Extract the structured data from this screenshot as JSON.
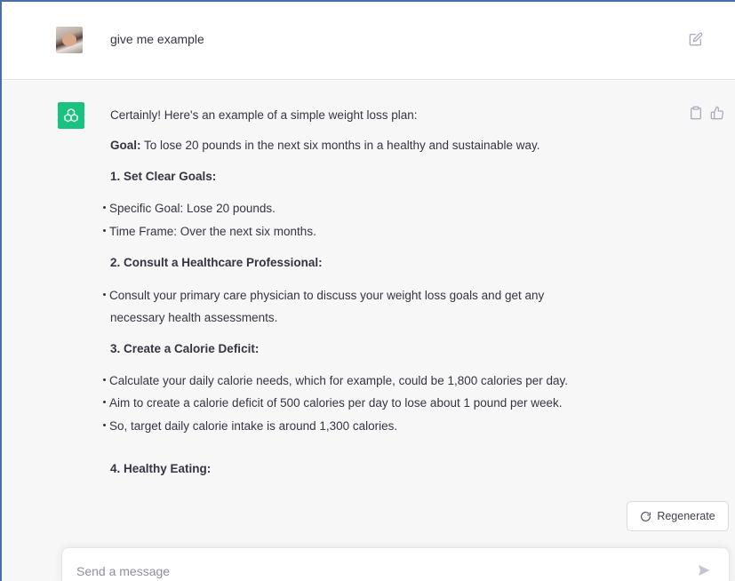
{
  "user_message": {
    "text": "give me example",
    "avatar_icon": "user-photo-avatar",
    "edit_icon": "pencil-square-icon"
  },
  "assistant_message": {
    "avatar_icon": "openai-logo-icon",
    "avatar_color": "#19c37d",
    "intro": "Certainly! Here's an example of a simple weight loss plan:",
    "goal_label": "Goal:",
    "goal_text": " To lose 20 pounds in the next six months in a healthy and sustainable way.",
    "section1_heading": "1. Set Clear Goals:",
    "section1_items": [
      "Specific Goal: Lose 20 pounds.",
      "Time Frame: Over the next six months."
    ],
    "section2_heading": "2. Consult a Healthcare Professional:",
    "section2_item_line1": "Consult your primary care physician to discuss your weight loss goals and get any",
    "section2_item_line2": "necessary health assessments.",
    "section3_heading": "3. Create a Calorie Deficit:",
    "section3_items": [
      "Calculate your daily calorie needs, which for example, could be 1,800 calories per day.",
      "Aim to create a calorie deficit of 500 calories per day to lose about 1 pound per week.",
      "So, target daily calorie intake is around 1,300 calories."
    ],
    "section4_heading": "4. Healthy Eating:",
    "copy_icon": "clipboard-icon",
    "thumbs_up_icon": "thumbs-up-icon"
  },
  "regenerate_button": {
    "label": "Regenerate",
    "icon": "refresh-icon"
  },
  "composer": {
    "placeholder": "Send a message",
    "send_icon": "send-icon"
  }
}
